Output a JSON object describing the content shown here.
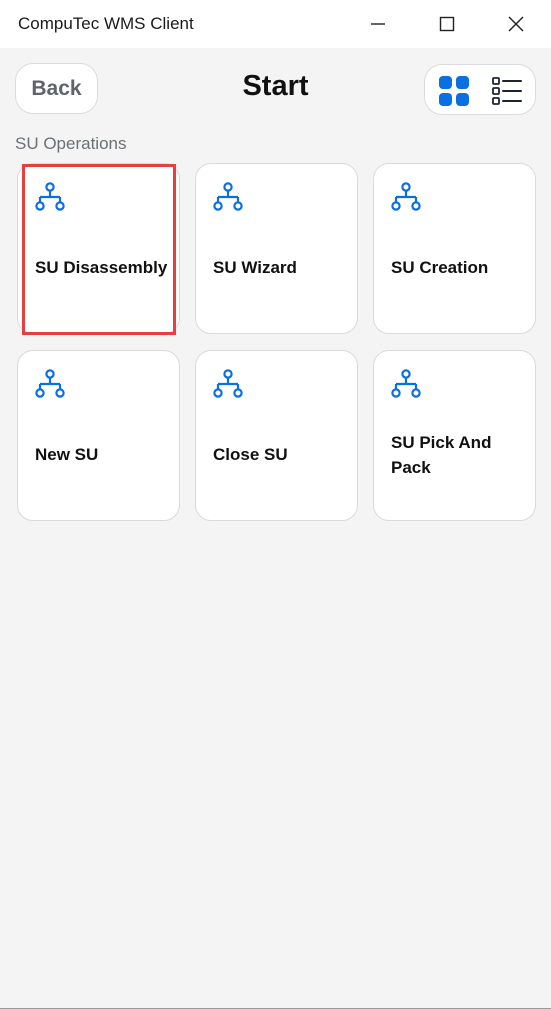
{
  "window": {
    "title": "CompuTec WMS Client",
    "controls": [
      "minimize-icon",
      "maximize-icon",
      "close-icon"
    ]
  },
  "header": {
    "back_label": "Back",
    "page_title": "Start",
    "view_modes": [
      "grid-view-icon",
      "list-view-icon"
    ],
    "active_view": "grid"
  },
  "section": {
    "label": "SU Operations"
  },
  "tiles": [
    {
      "label": "SU Disassembly",
      "icon": "hierarchy-icon",
      "highlighted": true
    },
    {
      "label": "SU Wizard",
      "icon": "hierarchy-icon"
    },
    {
      "label": "SU Creation",
      "icon": "hierarchy-icon"
    },
    {
      "label": "New SU",
      "icon": "hierarchy-icon"
    },
    {
      "label": "Close SU",
      "icon": "hierarchy-icon"
    },
    {
      "label": "SU Pick And Pack",
      "icon": "hierarchy-icon"
    }
  ],
  "colors": {
    "accent": "#0a6fe0",
    "highlight": "#e5403d",
    "background": "#f3f4f3"
  }
}
